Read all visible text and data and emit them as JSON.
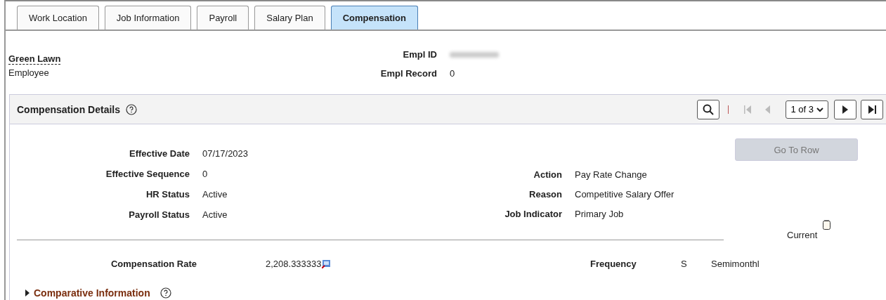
{
  "tabs": [
    {
      "label": "Work Location",
      "selected": false
    },
    {
      "label": "Job Information",
      "selected": false
    },
    {
      "label": "Payroll",
      "selected": false
    },
    {
      "label": "Salary Plan",
      "selected": false
    },
    {
      "label": "Compensation",
      "selected": true
    }
  ],
  "employee": {
    "name": "Green Lawn",
    "role": "Employee",
    "empl_id_label": "Empl ID",
    "empl_record_label": "Empl Record",
    "empl_record": "0"
  },
  "section": {
    "title": "Compensation Details",
    "pager": "1 of 3",
    "left_fields": [
      {
        "label": "Effective Date",
        "value": "07/17/2023"
      },
      {
        "label": "Effective Sequence",
        "value": "0"
      },
      {
        "label": "HR Status",
        "value": "Active"
      },
      {
        "label": "Payroll Status",
        "value": "Active"
      }
    ],
    "right_fields": [
      {
        "label": "Action",
        "value": "Pay Rate Change"
      },
      {
        "label": "Reason",
        "value": "Competitive Salary Offer"
      },
      {
        "label": "Job Indicator",
        "value": "Primary Job"
      }
    ],
    "go_to_row": {
      "label": "Go To Row",
      "disabled": true
    },
    "current": {
      "label": "Current",
      "checked": false
    },
    "rate": {
      "label": "Compensation Rate",
      "value": "2,208.333333"
    },
    "frequency": {
      "label": "Frequency",
      "code": "S",
      "name": "Semimonthl"
    },
    "comparative": {
      "label": "Comparative Information",
      "expanded": false
    }
  }
}
